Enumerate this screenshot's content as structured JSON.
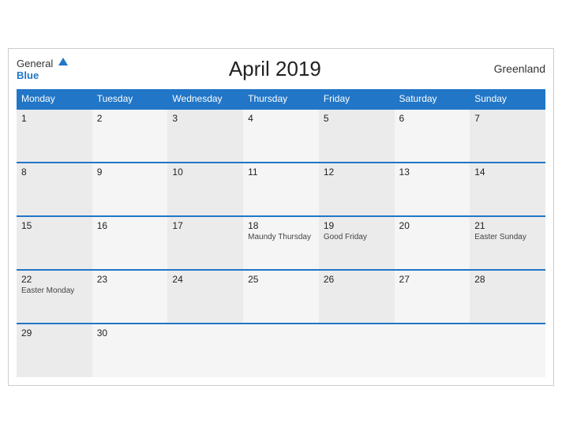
{
  "header": {
    "logo_general": "General",
    "logo_blue": "Blue",
    "title": "April 2019",
    "region": "Greenland"
  },
  "columns": [
    "Monday",
    "Tuesday",
    "Wednesday",
    "Thursday",
    "Friday",
    "Saturday",
    "Sunday"
  ],
  "weeks": [
    [
      {
        "day": "1",
        "event": ""
      },
      {
        "day": "2",
        "event": ""
      },
      {
        "day": "3",
        "event": ""
      },
      {
        "day": "4",
        "event": ""
      },
      {
        "day": "5",
        "event": ""
      },
      {
        "day": "6",
        "event": ""
      },
      {
        "day": "7",
        "event": ""
      }
    ],
    [
      {
        "day": "8",
        "event": ""
      },
      {
        "day": "9",
        "event": ""
      },
      {
        "day": "10",
        "event": ""
      },
      {
        "day": "11",
        "event": ""
      },
      {
        "day": "12",
        "event": ""
      },
      {
        "day": "13",
        "event": ""
      },
      {
        "day": "14",
        "event": ""
      }
    ],
    [
      {
        "day": "15",
        "event": ""
      },
      {
        "day": "16",
        "event": ""
      },
      {
        "day": "17",
        "event": ""
      },
      {
        "day": "18",
        "event": "Maundy Thursday"
      },
      {
        "day": "19",
        "event": "Good Friday"
      },
      {
        "day": "20",
        "event": ""
      },
      {
        "day": "21",
        "event": "Easter Sunday"
      }
    ],
    [
      {
        "day": "22",
        "event": "Easter Monday"
      },
      {
        "day": "23",
        "event": ""
      },
      {
        "day": "24",
        "event": ""
      },
      {
        "day": "25",
        "event": ""
      },
      {
        "day": "26",
        "event": ""
      },
      {
        "day": "27",
        "event": ""
      },
      {
        "day": "28",
        "event": ""
      }
    ],
    [
      {
        "day": "29",
        "event": ""
      },
      {
        "day": "30",
        "event": ""
      },
      {
        "day": "",
        "event": ""
      },
      {
        "day": "",
        "event": ""
      },
      {
        "day": "",
        "event": ""
      },
      {
        "day": "",
        "event": ""
      },
      {
        "day": "",
        "event": ""
      }
    ]
  ]
}
